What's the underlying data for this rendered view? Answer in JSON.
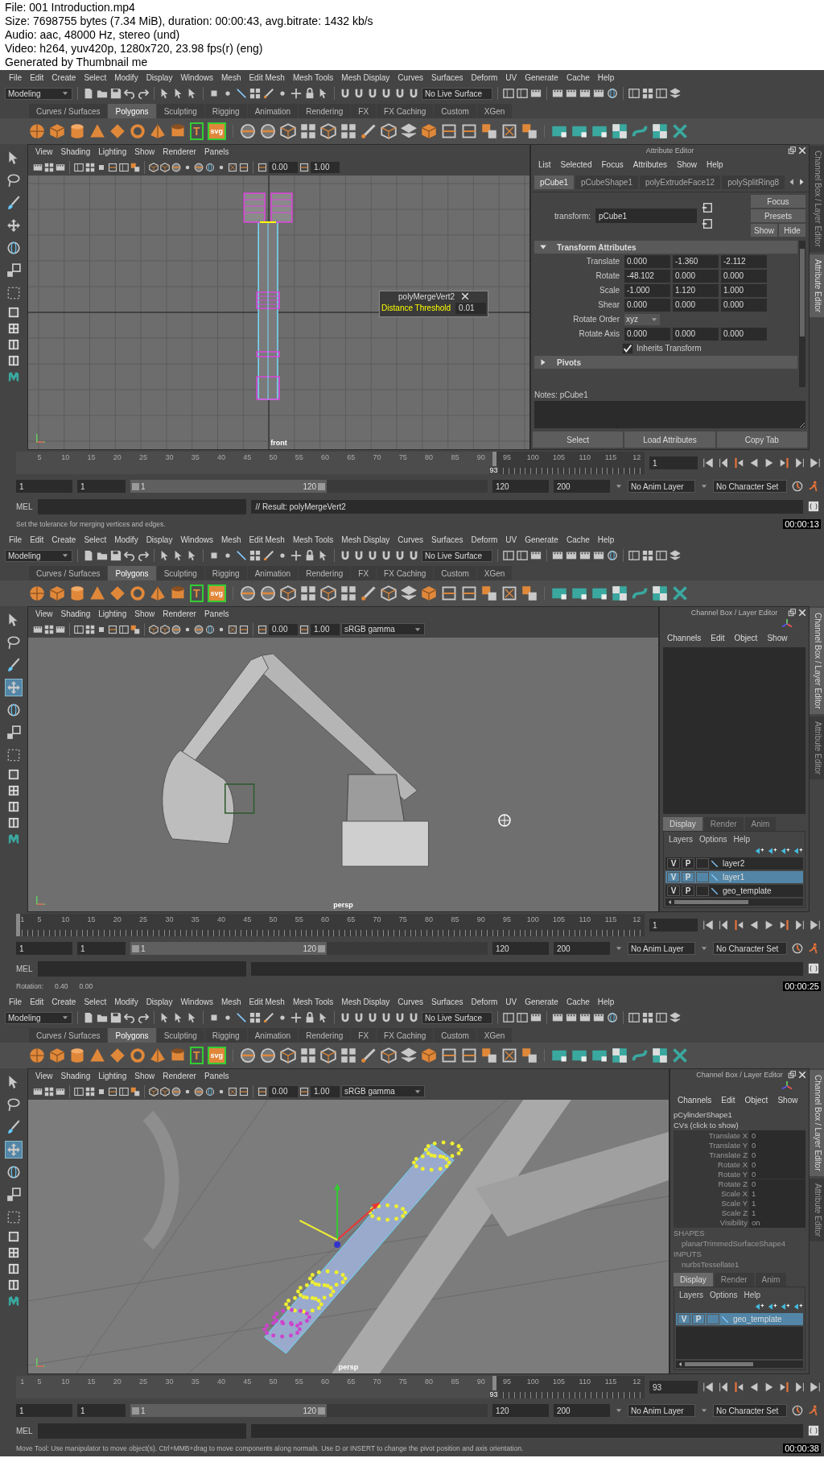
{
  "header": [
    "File: 001 Introduction.mp4",
    "Size: 7698755 bytes (7.34 MiB), duration: 00:00:43, avg.bitrate: 1432 kb/s",
    "Audio: aac, 48000 Hz, stereo (und)",
    "Video: h264, yuv420p, 1280x720, 23.98 fps(r) (eng)",
    "Generated by Thumbnail me"
  ],
  "frames": [
    {
      "menu": [
        "File",
        "Edit",
        "Create",
        "Select",
        "Modify",
        "Display",
        "Windows",
        "Mesh",
        "Edit Mesh",
        "Mesh Tools",
        "Mesh Display",
        "Curves",
        "Surfaces",
        "Deform",
        "UV",
        "Generate",
        "Cache",
        "Help"
      ],
      "workspace": "Modeling",
      "live_surface": "No Live Surface",
      "shelf_tabs": [
        {
          "label": "Curves / Surfaces",
          "selected": false
        },
        {
          "label": "Polygons",
          "selected": true
        },
        {
          "label": "Sculpting",
          "selected": false
        },
        {
          "label": "Rigging",
          "selected": false
        },
        {
          "label": "Animation",
          "selected": false
        },
        {
          "label": "Rendering",
          "selected": false
        },
        {
          "label": "FX",
          "selected": false
        },
        {
          "label": "FX Caching",
          "selected": false
        },
        {
          "label": "Custom",
          "selected": false
        },
        {
          "label": "XGen",
          "selected": false
        }
      ],
      "shelf_text_icons": [
        "T",
        "svg"
      ],
      "tools": [
        {
          "selected": false
        },
        {
          "selected": false
        },
        {
          "selected": false
        },
        {
          "selected": false
        },
        {
          "selected": false
        },
        {
          "selected": false
        },
        {
          "selected": false
        }
      ],
      "panel_menu": [
        "View",
        "Shading",
        "Lighting",
        "Show",
        "Renderer",
        "Panels"
      ],
      "panel_fields": [
        "0.00",
        "1.00"
      ],
      "viewport": {
        "kind": "front",
        "label": "front",
        "popup": {
          "title": "polyMergeVert2",
          "label": "Distance Threshold",
          "value": "0.01"
        }
      },
      "right_panel": {
        "kind": "attribute_editor",
        "title": "Attribute Editor",
        "menu": [
          "List",
          "Selected",
          "Focus",
          "Attributes",
          "Show",
          "Help"
        ],
        "tabs": [
          {
            "label": "pCube1",
            "selected": true
          },
          {
            "label": "pCubeShape1",
            "selected": false
          },
          {
            "label": "polyExtrudeFace12",
            "selected": false
          },
          {
            "label": "polySplitRing8",
            "selected": false
          }
        ],
        "transform_label": "transform:",
        "transform_value": "pCube1",
        "buttons": [
          "Focus",
          "Presets",
          "Show",
          "Hide"
        ],
        "sections": [
          {
            "title": "Transform Attributes",
            "expanded": true,
            "rows": [
              {
                "kind": "vector",
                "label": "Translate",
                "values": [
                  "0.000",
                  "-1.360",
                  "-2.112"
                ]
              },
              {
                "kind": "vector",
                "label": "Rotate",
                "values": [
                  "-48.102",
                  "0.000",
                  "0.000"
                ]
              },
              {
                "kind": "vector",
                "label": "Scale",
                "values": [
                  "-1.000",
                  "1.120",
                  "1.000"
                ]
              },
              {
                "kind": "vector",
                "label": "Shear",
                "values": [
                  "0.000",
                  "0.000",
                  "0.000"
                ]
              },
              {
                "kind": "dropdown",
                "label": "Rotate Order",
                "value": "xyz"
              },
              {
                "kind": "vector",
                "label": "Rotate Axis",
                "values": [
                  "0.000",
                  "0.000",
                  "0.000"
                ]
              },
              {
                "kind": "checkbox",
                "label": "Inherits Transform",
                "checked": true
              }
            ]
          },
          {
            "title": "Pivots",
            "expanded": false
          }
        ],
        "notes_label": "Notes:  pCube1",
        "bottom_buttons": [
          "Select",
          "Load Attributes",
          "Copy Tab"
        ]
      },
      "side_tabs": [
        {
          "label": "Channel Box / Layer Editor",
          "selected": false
        },
        {
          "label": "Attribute Editor",
          "selected": true
        }
      ],
      "timeline": {
        "ticks": [
          "5",
          "10",
          "15",
          "20",
          "25",
          "30",
          "35",
          "40",
          "45",
          "50",
          "55",
          "60",
          "65",
          "70",
          "75",
          "80",
          "85",
          "90",
          "95",
          "100",
          "105",
          "110",
          "115",
          "12"
        ],
        "current": "93",
        "level": 0.76,
        "frame": "1"
      },
      "range": {
        "start": "1",
        "playback_start": "1",
        "bar_start": "1",
        "bar_end": "120",
        "level": 0.55,
        "playback_end": "120",
        "end": "200",
        "anim_layer": "No Anim Layer",
        "character_set": "No Character Set"
      },
      "command": {
        "language": "MEL",
        "result": "// Result: polyMergeVert2"
      },
      "help_line": [
        "Set the tolerance for merging vertices and edges."
      ],
      "timestamp": "00:00:13"
    },
    {
      "menu": [
        "File",
        "Edit",
        "Create",
        "Select",
        "Modify",
        "Display",
        "Windows",
        "Mesh",
        "Edit Mesh",
        "Mesh Tools",
        "Mesh Display",
        "Curves",
        "Surfaces",
        "Deform",
        "UV",
        "Generate",
        "Cache",
        "Help"
      ],
      "workspace": "Modeling",
      "live_surface": "No Live Surface",
      "shelf_tabs": [
        {
          "label": "Curves / Surfaces",
          "selected": false
        },
        {
          "label": "Polygons",
          "selected": true
        },
        {
          "label": "Sculpting",
          "selected": false
        },
        {
          "label": "Rigging",
          "selected": false
        },
        {
          "label": "Animation",
          "selected": false
        },
        {
          "label": "Rendering",
          "selected": false
        },
        {
          "label": "FX",
          "selected": false
        },
        {
          "label": "FX Caching",
          "selected": false
        },
        {
          "label": "Custom",
          "selected": false
        },
        {
          "label": "XGen",
          "selected": false
        }
      ],
      "shelf_text_icons": [
        "T",
        "svg"
      ],
      "tools": [
        {
          "selected": false
        },
        {
          "selected": false
        },
        {
          "selected": false
        },
        {
          "selected": true
        },
        {
          "selected": false
        },
        {
          "selected": false
        },
        {
          "selected": false
        }
      ],
      "panel_menu": [
        "View",
        "Shading",
        "Lighting",
        "Show",
        "Renderer",
        "Panels"
      ],
      "panel_fields": [
        "0.00",
        "1.00"
      ],
      "color_space": "sRGB gamma",
      "viewport": {
        "kind": "excavator",
        "label": "persp"
      },
      "right_panel": {
        "kind": "channel_box",
        "title": "Channel Box / Layer Editor",
        "menu": [
          "Channels",
          "Edit",
          "Object",
          "Show"
        ],
        "layer_tabs": [
          {
            "label": "Display",
            "selected": true
          },
          {
            "label": "Render",
            "selected": false
          },
          {
            "label": "Anim",
            "selected": false
          }
        ],
        "layer_menu": [
          "Layers",
          "Options",
          "Help"
        ],
        "layers": [
          {
            "v": "V",
            "p": "P",
            "name": "layer2",
            "selected": false
          },
          {
            "v": "V",
            "p": "P",
            "name": "layer1",
            "selected": true
          },
          {
            "v": "V",
            "p": "P",
            "name": "geo_template",
            "selected": false
          }
        ]
      },
      "side_tabs": [
        {
          "label": "Channel Box / Layer Editor",
          "selected": true
        },
        {
          "label": "Attribute Editor",
          "selected": false
        }
      ],
      "timeline": {
        "start_label": "1",
        "ticks": [
          "5",
          "10",
          "15",
          "20",
          "25",
          "30",
          "35",
          "40",
          "45",
          "50",
          "55",
          "60",
          "65",
          "70",
          "75",
          "80",
          "85",
          "90",
          "95",
          "100",
          "105",
          "110",
          "115",
          "12"
        ],
        "level": 0,
        "frame": "1"
      },
      "range": {
        "start": "1",
        "playback_start": "1",
        "bar_start": "1",
        "bar_end": "120",
        "level": 0.55,
        "playback_end": "120",
        "end": "200",
        "anim_layer": "No Anim Layer",
        "character_set": "No Character Set"
      },
      "command": {
        "language": "MEL"
      },
      "help_line": [
        "Rotation:",
        "0.40",
        "0.00"
      ],
      "timestamp": "00:00:25"
    },
    {
      "menu": [
        "File",
        "Edit",
        "Create",
        "Select",
        "Modify",
        "Display",
        "Windows",
        "Mesh",
        "Edit Mesh",
        "Mesh Tools",
        "Mesh Display",
        "Curves",
        "Surfaces",
        "Deform",
        "UV",
        "Generate",
        "Cache",
        "Help"
      ],
      "workspace": "Modeling",
      "live_surface": "No Live Surface",
      "shelf_tabs": [
        {
          "label": "Curves / Surfaces",
          "selected": false
        },
        {
          "label": "Polygons",
          "selected": true
        },
        {
          "label": "Sculpting",
          "selected": false
        },
        {
          "label": "Rigging",
          "selected": false
        },
        {
          "label": "Animation",
          "selected": false
        },
        {
          "label": "Rendering",
          "selected": false
        },
        {
          "label": "FX",
          "selected": false
        },
        {
          "label": "FX Caching",
          "selected": false
        },
        {
          "label": "Custom",
          "selected": false
        },
        {
          "label": "XGen",
          "selected": false
        }
      ],
      "shelf_text_icons": [
        "T",
        "svg"
      ],
      "tools": [
        {
          "selected": false
        },
        {
          "selected": false
        },
        {
          "selected": false
        },
        {
          "selected": true
        },
        {
          "selected": false
        },
        {
          "selected": false
        },
        {
          "selected": false
        }
      ],
      "panel_menu": [
        "View",
        "Shading",
        "Lighting",
        "Show",
        "Renderer",
        "Panels"
      ],
      "panel_fields": [
        "0.00",
        "1.00"
      ],
      "color_space": "sRGB gamma",
      "viewport": {
        "kind": "closeup",
        "label": "persp"
      },
      "right_panel": {
        "kind": "channel_box",
        "title": "Channel Box / Layer Editor",
        "menu": [
          "Channels",
          "Edit",
          "Object",
          "Show"
        ],
        "node": "pCylinderShape1",
        "node_hint": "CVs (click to show)",
        "channels": [
          {
            "name": "Translate X",
            "value": "0"
          },
          {
            "name": "Translate Y",
            "value": "0"
          },
          {
            "name": "Translate Z",
            "value": "0"
          },
          {
            "name": "Rotate X",
            "value": "0"
          },
          {
            "name": "Rotate Y",
            "value": "0"
          },
          {
            "name": "Rotate Z",
            "value": "0"
          },
          {
            "name": "Scale X",
            "value": "1"
          },
          {
            "name": "Scale Y",
            "value": "1"
          },
          {
            "name": "Scale Z",
            "value": "1"
          },
          {
            "name": "Visibility",
            "value": "on"
          }
        ],
        "sections": [
          {
            "title": "SHAPES",
            "items": [
              "planarTrimmedSurfaceShape4"
            ]
          },
          {
            "title": "INPUTS",
            "items": [
              "nurbsTessellate1"
            ]
          }
        ],
        "layer_tabs": [
          {
            "label": "Display",
            "selected": true
          },
          {
            "label": "Render",
            "selected": false
          },
          {
            "label": "Anim",
            "selected": false
          }
        ],
        "layer_menu": [
          "Layers",
          "Options",
          "Help"
        ],
        "layers": [
          {
            "v": "V",
            "p": "P",
            "name": "geo_template",
            "selected": true
          }
        ]
      },
      "side_tabs": [
        {
          "label": "Channel Box / Layer Editor",
          "selected": true
        },
        {
          "label": "Attribute Editor",
          "selected": false
        }
      ],
      "timeline": {
        "start_label": "1",
        "ticks": [
          "5",
          "10",
          "15",
          "20",
          "25",
          "30",
          "35",
          "40",
          "45",
          "50",
          "55",
          "60",
          "65",
          "70",
          "75",
          "80",
          "85",
          "90",
          "95",
          "100",
          "105",
          "110",
          "115",
          "12"
        ],
        "current": "93",
        "level": 0.76,
        "frame": "93"
      },
      "range": {
        "start": "1",
        "playback_start": "1",
        "bar_start": "1",
        "bar_end": "120",
        "level": 0.55,
        "playback_end": "120",
        "end": "200",
        "anim_layer": "No Anim Layer",
        "character_set": "No Character Set"
      },
      "command": {
        "language": "MEL"
      },
      "help_line": [
        "Move Tool: Use manipulator to move object(s). Ctrl+MMB+drag to move components along normals. Use D or INSERT to change the pivot position and axis orientation."
      ],
      "timestamp": "00:00:38"
    }
  ]
}
